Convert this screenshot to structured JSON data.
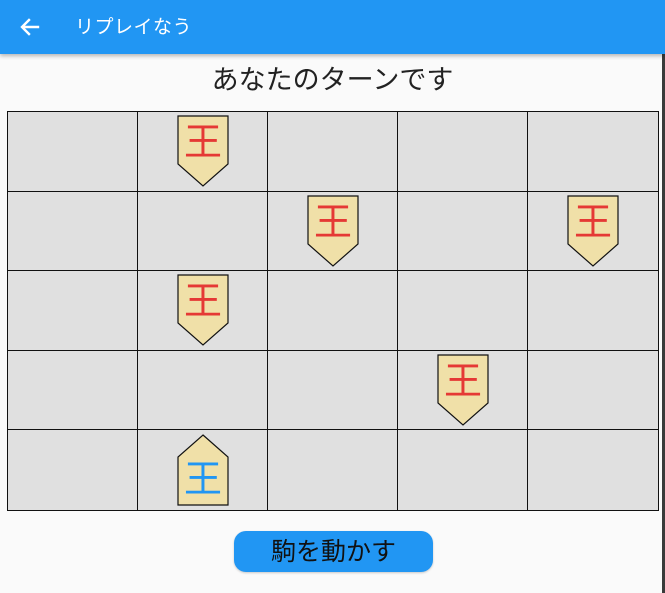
{
  "appbar": {
    "back_icon": "arrow-back-icon",
    "title": "リプレイなう",
    "color": "#2196f3"
  },
  "status": {
    "turn_text": "あなたのターンです"
  },
  "board": {
    "rows": 5,
    "cols": 5,
    "cell_color": "#e0e0e0",
    "line_color": "#111111",
    "pieces": [
      {
        "row": 0,
        "col": 1,
        "glyph": "王",
        "owner": "opponent",
        "color": "#e53935",
        "facing": "down"
      },
      {
        "row": 1,
        "col": 2,
        "glyph": "王",
        "owner": "opponent",
        "color": "#e53935",
        "facing": "down"
      },
      {
        "row": 1,
        "col": 4,
        "glyph": "王",
        "owner": "opponent",
        "color": "#e53935",
        "facing": "down"
      },
      {
        "row": 2,
        "col": 1,
        "glyph": "王",
        "owner": "opponent",
        "color": "#e53935",
        "facing": "down"
      },
      {
        "row": 3,
        "col": 3,
        "glyph": "王",
        "owner": "opponent",
        "color": "#e53935",
        "facing": "down"
      },
      {
        "row": 4,
        "col": 1,
        "glyph": "王",
        "owner": "player",
        "color": "#2196f3",
        "facing": "up"
      }
    ],
    "piece_fill": "#f0e0a8"
  },
  "actions": {
    "move_label": "駒を動かす"
  }
}
